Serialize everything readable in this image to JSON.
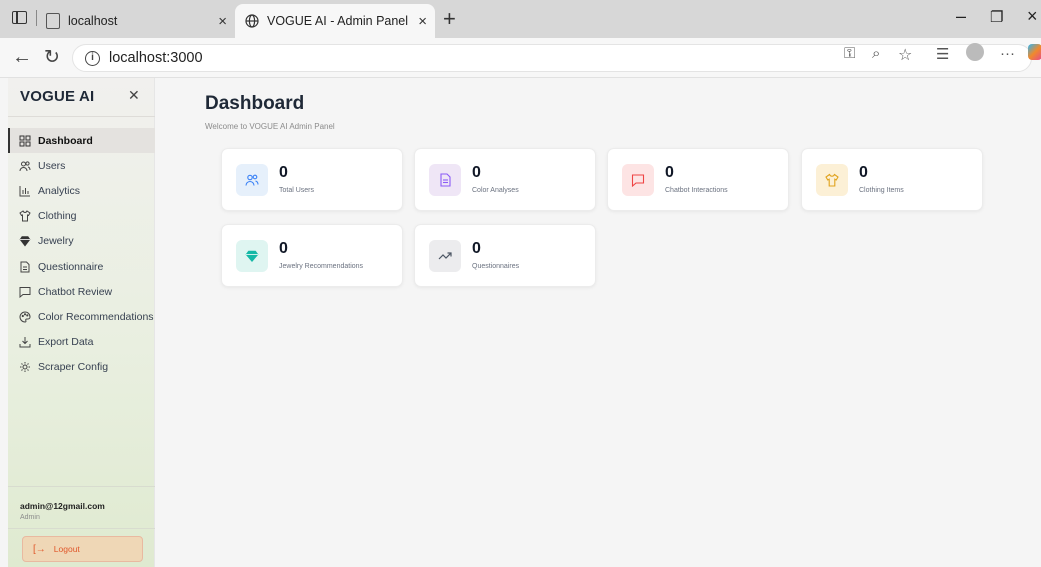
{
  "browser": {
    "tabs": [
      {
        "label": "localhost"
      },
      {
        "label": "VOGUE AI - Admin Panel"
      }
    ],
    "url": "localhost:3000"
  },
  "sidebar": {
    "brand": "VOGUE AI",
    "items": [
      {
        "label": "Dashboard",
        "icon": "grid-icon",
        "active": true
      },
      {
        "label": "Users",
        "icon": "users-icon"
      },
      {
        "label": "Analytics",
        "icon": "bar-chart-icon"
      },
      {
        "label": "Clothing",
        "icon": "shirt-icon"
      },
      {
        "label": "Jewelry",
        "icon": "gem-icon"
      },
      {
        "label": "Questionnaire",
        "icon": "document-icon"
      },
      {
        "label": "Chatbot Review",
        "icon": "chat-icon"
      },
      {
        "label": "Color Recommendations",
        "icon": "palette-icon"
      },
      {
        "label": "Export Data",
        "icon": "download-icon"
      },
      {
        "label": "Scraper Config",
        "icon": "settings-icon"
      }
    ],
    "user": {
      "email": "admin@12gmail.com",
      "role": "Admin"
    },
    "logout_label": "Logout"
  },
  "main": {
    "title": "Dashboard",
    "subtitle": "Welcome to VOGUE AI Admin Panel",
    "stats": [
      {
        "value": "0",
        "label": "Total Users",
        "icon": "users-icon",
        "color": "#3b82f6",
        "bg": "#e6f0fb"
      },
      {
        "value": "0",
        "label": "Color Analyses",
        "icon": "document-icon",
        "color": "#8b5cf6",
        "bg": "#efe6f6"
      },
      {
        "value": "0",
        "label": "Chatbot Interactions",
        "icon": "chat-icon",
        "color": "#ef4444",
        "bg": "#fde4e4"
      },
      {
        "value": "0",
        "label": "Clothing Items",
        "icon": "shirt-icon",
        "color": "#e0a21c",
        "bg": "#fcf0d6"
      },
      {
        "value": "0",
        "label": "Jewelry Recommendations",
        "icon": "gem-icon",
        "color": "#14b8a6",
        "bg": "#dff5f1"
      },
      {
        "value": "0",
        "label": "Questionnaires",
        "icon": "trend-icon",
        "color": "#4b5563",
        "bg": "#ececee"
      }
    ]
  }
}
